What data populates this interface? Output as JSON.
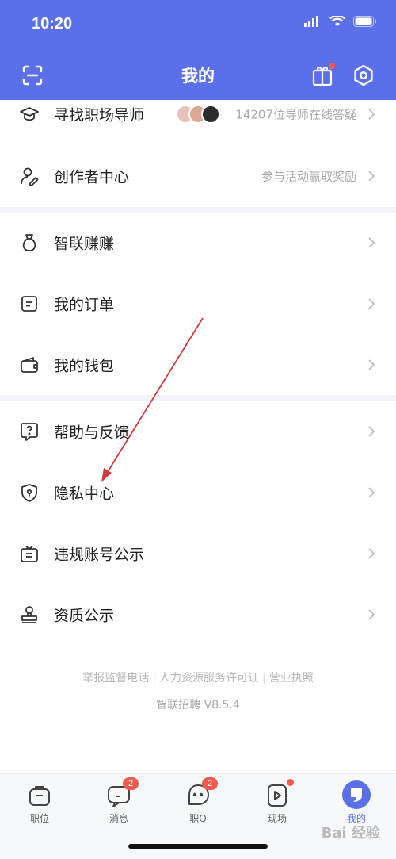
{
  "status": {
    "time": "10:20"
  },
  "nav": {
    "title": "我的"
  },
  "items": [
    {
      "label": "寻找职场导师",
      "right": "14207位导师在线答疑"
    },
    {
      "label": "创作者中心",
      "right": "参与活动赢取奖励"
    },
    {
      "label": "智联赚赚"
    },
    {
      "label": "我的订单"
    },
    {
      "label": "我的钱包"
    },
    {
      "label": "帮助与反馈"
    },
    {
      "label": "隐私中心"
    },
    {
      "label": "违规账号公示"
    },
    {
      "label": "资质公示"
    }
  ],
  "footer": {
    "links": [
      "举报监督电话",
      "人力资源服务许可证",
      "营业执照"
    ],
    "version": "智联招聘 V8.5.4"
  },
  "tabs": [
    {
      "label": "职位"
    },
    {
      "label": "消息",
      "badge": "2"
    },
    {
      "label": "职Q",
      "badge": "2"
    },
    {
      "label": "现场"
    },
    {
      "label": "我的"
    }
  ],
  "watermark": "Bai 经验",
  "colors": {
    "header": "#5B6FE8",
    "active": "#5B6FE8",
    "badge": "#F25A4D"
  }
}
